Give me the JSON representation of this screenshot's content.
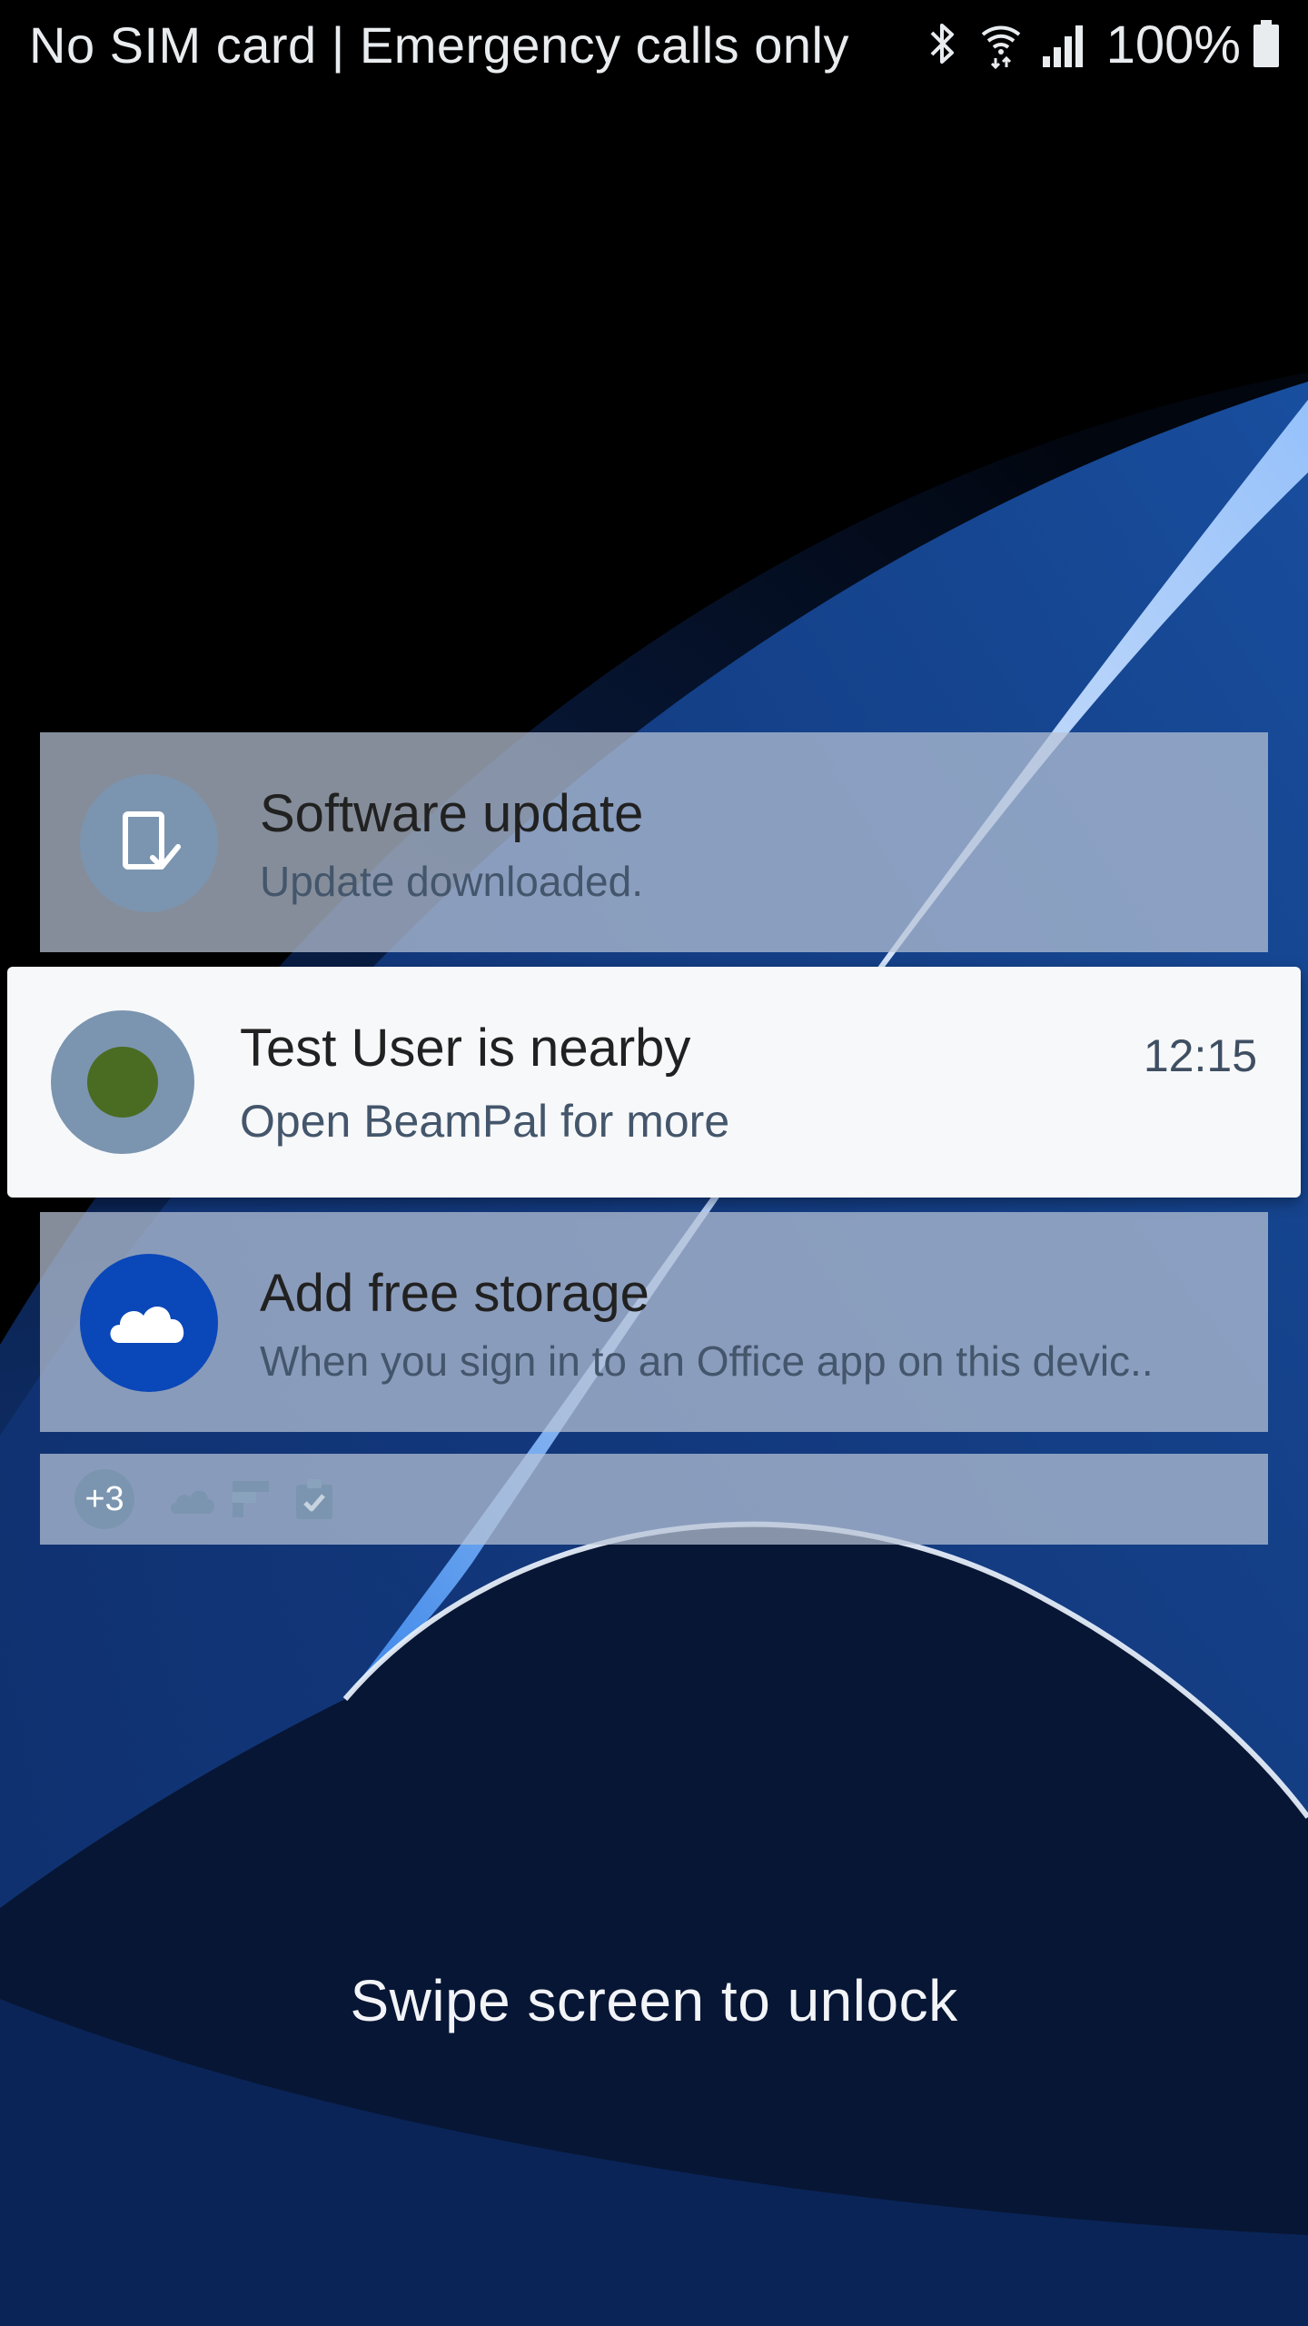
{
  "status_bar": {
    "carrier_text": "No SIM card | Emergency calls only",
    "icons": [
      "bluetooth-icon",
      "wifi-icon",
      "signal-icon",
      "battery-icon"
    ],
    "battery_percent": "100%"
  },
  "notifications": [
    {
      "icon": "software-update-icon",
      "title": "Software update",
      "text": "Update downloaded."
    },
    {
      "icon": "beampal-icon",
      "title": "Test User is nearby",
      "text": "Open BeamPal for more",
      "time": "12:15"
    },
    {
      "icon": "onedrive-cloud-icon",
      "title": "Add free storage",
      "text": "When you sign in to an Office app on this devic.."
    }
  ],
  "overflow": {
    "count_label": "+3",
    "icons": [
      "cloud-icon",
      "flipboard-icon",
      "clipboard-check-icon"
    ]
  },
  "lock_hint": "Swipe screen to unlock",
  "colors": {
    "onedrive_blue": "#0a47b8",
    "app_circle_gray": "#7b95b0",
    "beampal_green": "#4a6b22"
  }
}
